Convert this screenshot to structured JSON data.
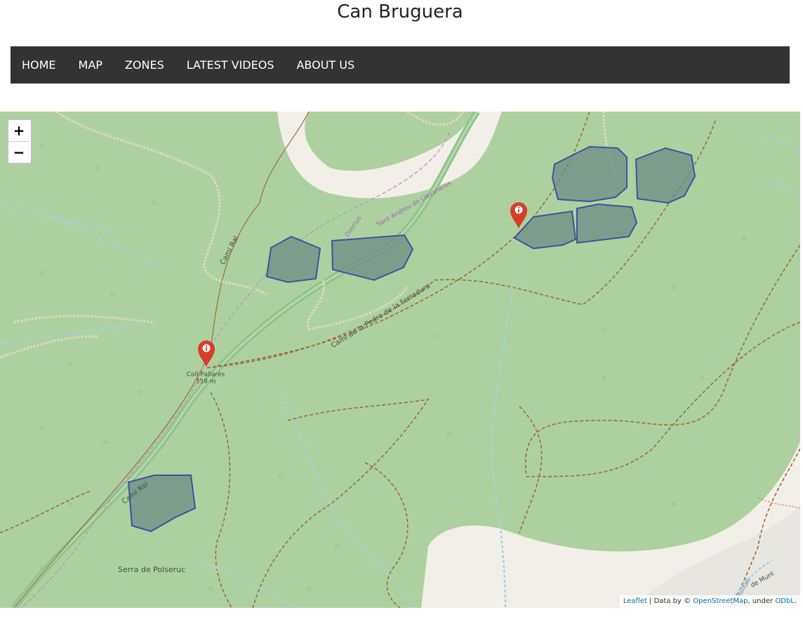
{
  "site": {
    "title": "Can Bruguera"
  },
  "nav": {
    "items": [
      {
        "label": "HOME"
      },
      {
        "label": "MAP"
      },
      {
        "label": "ZONES"
      },
      {
        "label": "LATEST VIDEOS"
      },
      {
        "label": "ABOUT US"
      }
    ]
  },
  "map": {
    "zoom_in": "+",
    "zoom_out": "−",
    "labels": {
      "cami_ral_1": "Camí Ral",
      "cami_ral_2": "Camí Ral",
      "dosrius": "Dosrius",
      "sant_andreu": "Sant Andreu de Llavaneres",
      "pedra_ferradura": "Camí de la Pedra de la Ferradura",
      "coll_pallares": "Coll Pallarès",
      "coll_elevation": "359 m",
      "serra": "Serra de Polseruc",
      "montalt": "Montalt",
      "de_munt": "de Munt"
    },
    "attribution": {
      "leaflet": "Leaflet",
      "sep": " | Data by © ",
      "osm": "OpenStreetMap",
      "under": ", under ",
      "odbl": "ODbL",
      "end": "."
    },
    "colors": {
      "forest": "#add19e",
      "zone_fill": "#6e8a86",
      "zone_stroke": "#3f51a0",
      "marker": "#d63e2a",
      "path": "#a0693c",
      "stream": "#a6cfe6"
    },
    "markers": [
      {
        "icon": "info-icon"
      },
      {
        "icon": "info-icon"
      }
    ]
  }
}
